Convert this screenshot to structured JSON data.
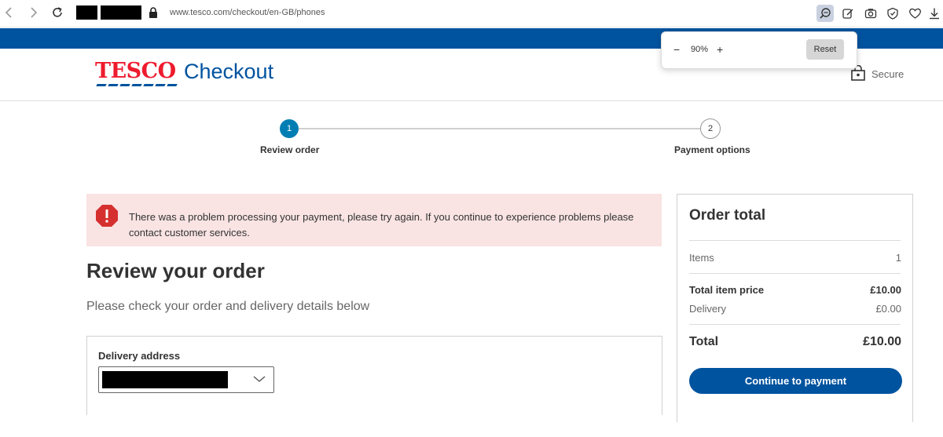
{
  "browser": {
    "url": "www.tesco.com/checkout/en-GB/phones",
    "back_icon": "chevron-left-icon",
    "forward_icon": "chevron-right-icon",
    "reload_icon": "reload-icon"
  },
  "zoom": {
    "minus": "−",
    "value": "90%",
    "plus": "+",
    "reset_label": "Reset"
  },
  "header": {
    "logo_text": "TESCO",
    "title": "Checkout",
    "secure_label": "Secure",
    "brand_red": "#ee1c2e",
    "brand_blue": "#00539f"
  },
  "stepper": {
    "steps": [
      {
        "number": "1",
        "label": "Review order"
      },
      {
        "number": "2",
        "label": "Payment options"
      }
    ],
    "active_color": "#007eb3"
  },
  "error": {
    "message": "There was a problem processing your payment, please try again. If you continue to experience problems please contact customer services."
  },
  "main": {
    "title": "Review your order",
    "subtitle": "Please check your order and delivery details below",
    "delivery_label": "Delivery address"
  },
  "order_total": {
    "title": "Order total",
    "items_label": "Items",
    "items_value": "1",
    "total_item_price_label": "Total item price",
    "total_item_price_value": "£10.00",
    "delivery_label": "Delivery",
    "delivery_value": "£0.00",
    "total_label": "Total",
    "total_value": "£10.00",
    "button_label": "Continue to payment"
  }
}
